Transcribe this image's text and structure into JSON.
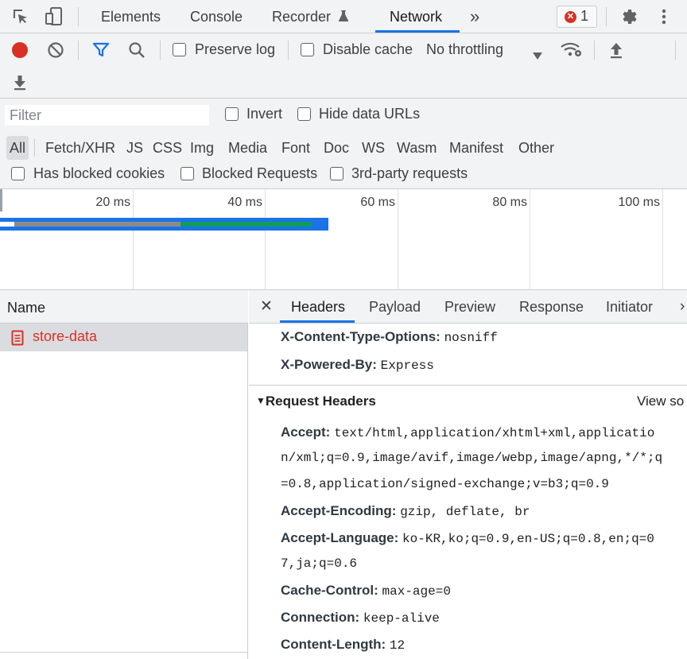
{
  "devtools": {
    "tabs": [
      "Elements",
      "Console",
      "Recorder",
      "Network"
    ],
    "active_tab": "Network",
    "more_tabs": "»",
    "error_count": "1"
  },
  "toolbar": {
    "preserve_log": "Preserve log",
    "disable_cache": "Disable cache",
    "throttling": "No throttling",
    "preserve_log_checked": false,
    "disable_cache_checked": false
  },
  "filter": {
    "placeholder": "Filter",
    "invert": "Invert",
    "hide_data_urls": "Hide data URLs",
    "types": [
      "All",
      "Fetch/XHR",
      "JS",
      "CSS",
      "Img",
      "Media",
      "Font",
      "Doc",
      "WS",
      "Wasm",
      "Manifest",
      "Other"
    ],
    "selected_type": "All",
    "has_blocked_cookies": "Has blocked cookies",
    "blocked_requests": "Blocked Requests",
    "third_party": "3rd-party requests"
  },
  "overview": {
    "ticks": [
      "20 ms",
      "40 ms",
      "60 ms",
      "80 ms",
      "100 ms"
    ]
  },
  "requests": {
    "column": "Name",
    "items": [
      {
        "name": "store-data",
        "color": "#d93025"
      }
    ]
  },
  "details": {
    "tabs": [
      "Headers",
      "Payload",
      "Preview",
      "Response",
      "Initiator"
    ],
    "active_tab": "Headers",
    "response_headers_tail": [
      {
        "name": "X-Content-Type-Options:",
        "value": "nosniff"
      },
      {
        "name": "X-Powered-By:",
        "value": "Express"
      }
    ],
    "request_section": "Request Headers",
    "view_source": "View so",
    "accept_name": "Accept:",
    "accept_lines": [
      "text/html,application/xhtml+xml,applicatio",
      "n/xml;q=0.9,image/avif,image/webp,image/apng,*/*;q",
      "=0.8,application/signed-exchange;v=b3;q=0.9"
    ],
    "accept_encoding_name": "Accept-Encoding:",
    "accept_encoding_value": "gzip, deflate, br",
    "accept_language_name": "Accept-Language:",
    "accept_language_lines": [
      "ko-KR,ko;q=0.9,en-US;q=0.8,en;q=0",
      "7,ja;q=0.6"
    ],
    "more_headers": [
      {
        "name": "Cache-Control:",
        "value": "max-age=0"
      },
      {
        "name": "Connection:",
        "value": "keep-alive"
      },
      {
        "name": "Content-Length:",
        "value": "12"
      }
    ]
  },
  "colors": {
    "accent": "#1a73e8",
    "record": "#d93025",
    "bar_gray": "#8c8c8c",
    "bar_green": "#0f9d58",
    "bar_blue": "#1a73e8"
  }
}
